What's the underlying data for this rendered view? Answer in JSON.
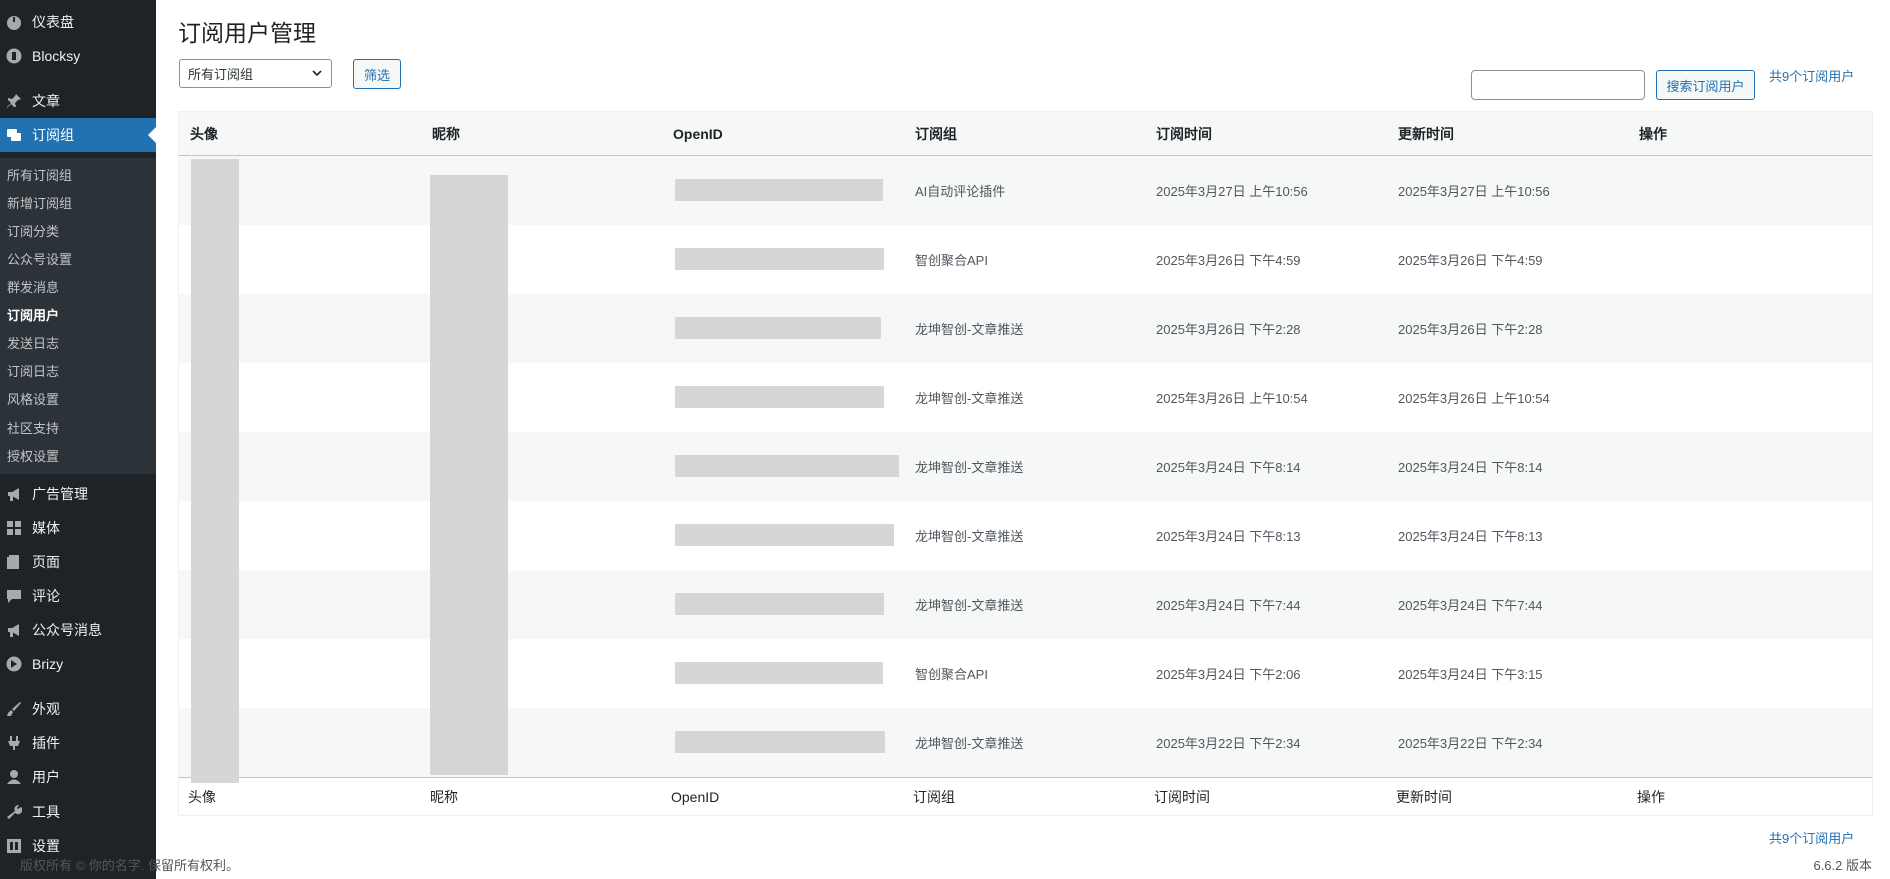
{
  "sidebar": {
    "top_items": [
      {
        "label": "仪表盘",
        "icon": "dashboard-icon"
      },
      {
        "label": "Blocksy",
        "icon": "blocksy-icon"
      },
      {
        "label": "文章",
        "icon": "pin-icon"
      },
      {
        "label": "订阅组",
        "icon": "comments-icon"
      },
      {
        "label": "广告管理",
        "icon": "megaphone-icon"
      },
      {
        "label": "媒体",
        "icon": "media-icon"
      },
      {
        "label": "页面",
        "icon": "pages-icon"
      },
      {
        "label": "评论",
        "icon": "comment-icon"
      },
      {
        "label": "公众号消息",
        "icon": "megaphone-icon"
      },
      {
        "label": "Brizy",
        "icon": "brizy-icon"
      },
      {
        "label": "外观",
        "icon": "brush-icon"
      },
      {
        "label": "插件",
        "icon": "plugins-icon"
      },
      {
        "label": "用户",
        "icon": "users-icon"
      },
      {
        "label": "工具",
        "icon": "tools-icon"
      },
      {
        "label": "设置",
        "icon": "settings-icon"
      }
    ],
    "sub_items": [
      {
        "label": "所有订阅组"
      },
      {
        "label": "新增订阅组"
      },
      {
        "label": "订阅分类"
      },
      {
        "label": "公众号设置"
      },
      {
        "label": "群发消息"
      },
      {
        "label": "订阅用户"
      },
      {
        "label": "发送日志"
      },
      {
        "label": "订阅日志"
      },
      {
        "label": "风格设置"
      },
      {
        "label": "社区支持"
      },
      {
        "label": "授权设置"
      }
    ]
  },
  "page": {
    "title": "订阅用户管理",
    "filter_select": "所有订阅组",
    "filter_button": "筛选",
    "search_button": "搜索订阅用户",
    "count_text": "共9个订阅用户"
  },
  "table": {
    "columns": [
      "头像",
      "昵称",
      "OpenID",
      "订阅组",
      "订阅时间",
      "更新时间",
      "操作"
    ],
    "rows": [
      {
        "group": "AI自动评论插件",
        "subscribed": "2025年3月27日 上午10:56",
        "updated": "2025年3月27日 上午10:56"
      },
      {
        "group": "智创聚合API",
        "subscribed": "2025年3月26日 下午4:59",
        "updated": "2025年3月26日 下午4:59"
      },
      {
        "group": "龙坤智创-文章推送",
        "subscribed": "2025年3月26日 下午2:28",
        "updated": "2025年3月26日 下午2:28"
      },
      {
        "group": "龙坤智创-文章推送",
        "subscribed": "2025年3月26日 上午10:54",
        "updated": "2025年3月26日 上午10:54"
      },
      {
        "group": "龙坤智创-文章推送",
        "subscribed": "2025年3月24日 下午8:14",
        "updated": "2025年3月24日 下午8:14"
      },
      {
        "group": "龙坤智创-文章推送",
        "subscribed": "2025年3月24日 下午8:13",
        "updated": "2025年3月24日 下午8:13"
      },
      {
        "group": "龙坤智创-文章推送",
        "subscribed": "2025年3月24日 下午7:44",
        "updated": "2025年3月24日 下午7:44"
      },
      {
        "group": "智创聚合API",
        "subscribed": "2025年3月24日 下午2:06",
        "updated": "2025年3月24日 下午3:15"
      },
      {
        "group": "龙坤智创-文章推送",
        "subscribed": "2025年3月22日 下午2:34",
        "updated": "2025年3月22日 下午2:34"
      }
    ]
  },
  "footer": {
    "copyright": "版权所有 © 你的名字. 保留所有权利。",
    "version": "6.6.2 版本"
  },
  "colors": {
    "sidebar_bg": "#1d2327",
    "accent": "#2271b1",
    "row_alt": "#f6f7f7"
  }
}
